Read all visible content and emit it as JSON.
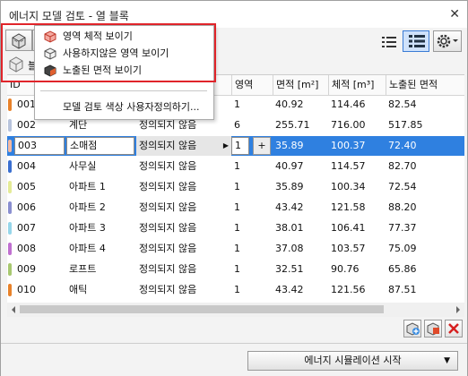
{
  "window": {
    "title": "에너지 모델 검토 - 열 블록",
    "close_glyph": "✕"
  },
  "toolbar": {
    "model_button_icon": "model-cube-icon",
    "partial_label": "블",
    "list_view_icon": "list-view-icon",
    "detail_view_icon": "detail-view-icon",
    "settings_icon": "gear-icon"
  },
  "menu": {
    "items": [
      {
        "label": "영역 체적 보이기",
        "icon": "zone-volume-icon"
      },
      {
        "label": "사용하지않은 영역 보이기",
        "icon": "unused-zone-icon"
      },
      {
        "label": "노출된 면적 보이기",
        "icon": "exposed-surface-icon"
      }
    ],
    "extra_item": "모델 검토 색상 사용자정의하기..."
  },
  "table": {
    "columns": [
      "ID",
      "",
      "",
      "영역",
      "면적 [m²]",
      "체적 [m³]",
      "노출된 면적"
    ],
    "rows": [
      {
        "color": "#e8822a",
        "id": "001",
        "name": "",
        "op": "",
        "zones": "1",
        "area": "40.92",
        "volume": "114.46",
        "exposed": "82.54"
      },
      {
        "color": "#b8c4dc",
        "id": "002",
        "name": "계단",
        "op": "정의되지 않음",
        "zones": "6",
        "area": "255.71",
        "volume": "716.00",
        "exposed": "517.85"
      },
      {
        "color": "#f2b9a2",
        "id": "003",
        "name": "소매점",
        "op": "정의되지 않음",
        "zones": "1",
        "area": "35.89",
        "volume": "100.37",
        "exposed": "72.40",
        "selected": true,
        "plus": "+"
      },
      {
        "color": "#3a6fd0",
        "id": "004",
        "name": "사무실",
        "op": "정의되지 않음",
        "zones": "1",
        "area": "40.97",
        "volume": "114.57",
        "exposed": "82.70"
      },
      {
        "color": "#e4eb96",
        "id": "005",
        "name": "아파트 1",
        "op": "정의되지 않음",
        "zones": "1",
        "area": "35.89",
        "volume": "100.34",
        "exposed": "72.54"
      },
      {
        "color": "#8a8fd0",
        "id": "006",
        "name": "아파트 2",
        "op": "정의되지 않음",
        "zones": "1",
        "area": "43.42",
        "volume": "121.58",
        "exposed": "88.20"
      },
      {
        "color": "#96d6ea",
        "id": "007",
        "name": "아파트 3",
        "op": "정의되지 않음",
        "zones": "1",
        "area": "38.01",
        "volume": "106.41",
        "exposed": "77.37"
      },
      {
        "color": "#c070d0",
        "id": "008",
        "name": "아파트 4",
        "op": "정의되지 않음",
        "zones": "1",
        "area": "37.08",
        "volume": "103.57",
        "exposed": "75.09"
      },
      {
        "color": "#a8c870",
        "id": "009",
        "name": "로프트",
        "op": "정의되지 않음",
        "zones": "1",
        "area": "32.51",
        "volume": "90.76",
        "exposed": "65.86"
      },
      {
        "color": "#e8822a",
        "id": "010",
        "name": "애틱",
        "op": "정의되지 않음",
        "zones": "1",
        "area": "43.42",
        "volume": "121.56",
        "exposed": "87.51"
      }
    ]
  },
  "bottom": {
    "simulate_button": "에너지 시뮬레이션 시작",
    "dropdown_glyph": "▼"
  },
  "colors": {
    "selection": "#2f80e0",
    "highlight_box": "#e0242a"
  }
}
